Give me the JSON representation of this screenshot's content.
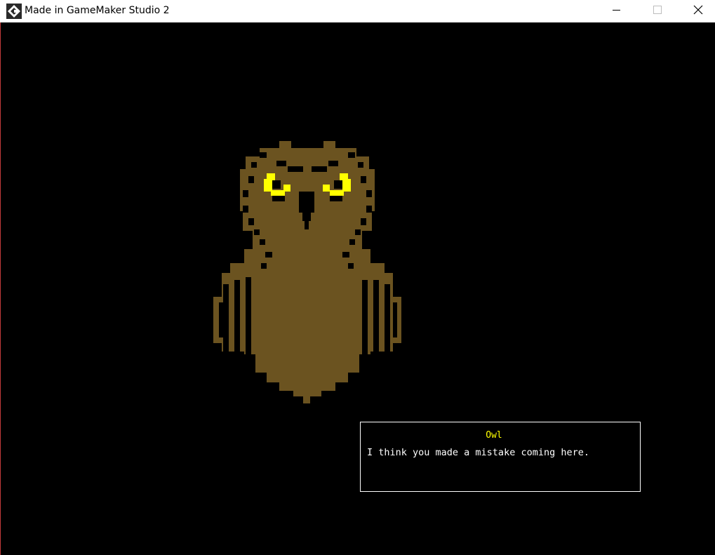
{
  "window": {
    "title": "Made in GameMaker Studio 2",
    "controls": [
      "minimize-icon",
      "maximize-icon",
      "close-icon"
    ]
  },
  "scene": {
    "background_color": "#000000",
    "character": "owl-sprite",
    "owl_body_color": "#6b5320",
    "owl_eye_color": "#ffff00"
  },
  "dialog": {
    "speaker": "Owl",
    "text": "I think you made a mistake coming here."
  }
}
